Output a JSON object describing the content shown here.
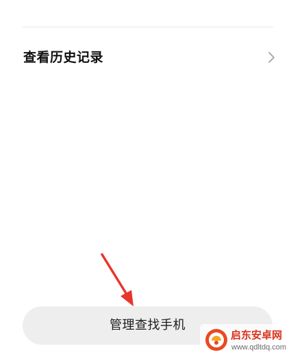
{
  "history": {
    "label": "查看历史记录",
    "chevron_icon": "chevron-right-icon"
  },
  "manage": {
    "label": "管理查找手机"
  },
  "annotation": {
    "arrow_icon": "red-arrow-icon",
    "color": "#e8352b"
  },
  "watermark": {
    "title": "启东安卓网",
    "url": "www.qdltdq.com",
    "logo_icon": "qidong-logo-icon",
    "accent": "#d9321e"
  },
  "colors": {
    "background": "#ffffff",
    "button_bg": "#eeeeee",
    "text": "#111111",
    "divider": "#e8e8e8"
  }
}
